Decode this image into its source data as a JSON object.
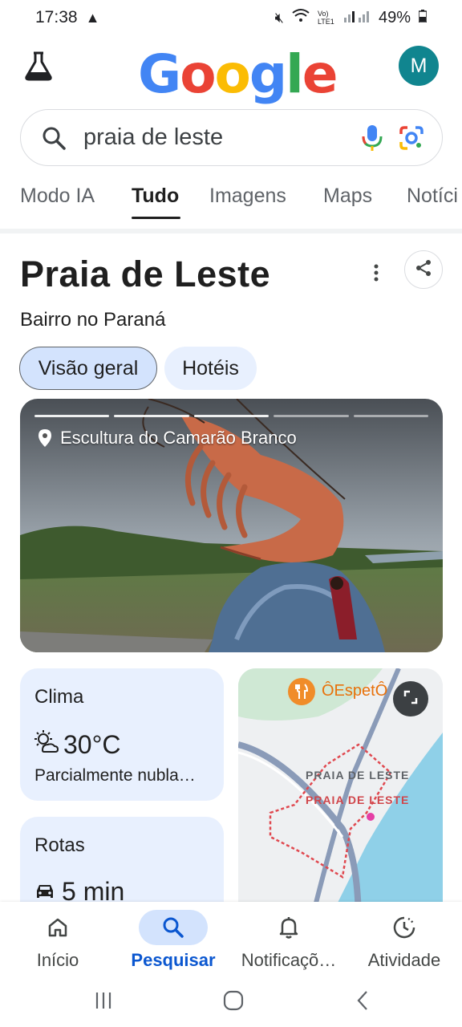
{
  "status_bar": {
    "time": "17:38",
    "battery": "49%",
    "network": "Vo) LTE1"
  },
  "header": {
    "logo_text": "Google",
    "avatar_letter": "M"
  },
  "search": {
    "query": "praia de leste"
  },
  "tabs": [
    {
      "label": "Modo IA"
    },
    {
      "label": "Tudo"
    },
    {
      "label": "Imagens"
    },
    {
      "label": "Maps"
    },
    {
      "label": "Notíci"
    }
  ],
  "result": {
    "title": "Praia de Leste",
    "subtitle": "Bairro no Paraná",
    "chips": [
      "Visão geral",
      "Hotéis"
    ],
    "photo_caption": "Escultura do Camarão Branco"
  },
  "weather": {
    "title": "Clima",
    "temp": "30°C",
    "desc": "Parcialmente nubla…"
  },
  "routes": {
    "title": "Rotas",
    "time": "5 min"
  },
  "map": {
    "place_label": "ÔEspetÔ",
    "area_label_1": "PRAIA DE LESTE",
    "area_label_2": "PRAIA DE LESTE"
  },
  "bottom_nav": [
    {
      "label": "Início",
      "icon": "home-icon"
    },
    {
      "label": "Pesquisar",
      "icon": "search-icon"
    },
    {
      "label": "Notificaçõ…",
      "icon": "bell-icon"
    },
    {
      "label": "Atividade",
      "icon": "activity-icon"
    }
  ],
  "colors": {
    "accent": "#0b57d0",
    "chip_bg": "#d3e3fd",
    "card_bg": "#e8f0fe",
    "avatar": "#10858f"
  }
}
